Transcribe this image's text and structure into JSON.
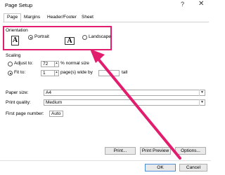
{
  "window": {
    "title": "Page Setup",
    "help": "?",
    "close": "✕"
  },
  "tabs": [
    {
      "label": "Page"
    },
    {
      "label": "Margins"
    },
    {
      "label": "Header/Footer"
    },
    {
      "label": "Sheet"
    }
  ],
  "orientation": {
    "label": "Orientation",
    "portrait": "Portrait",
    "landscape": "Landscape",
    "icon_letter": "A"
  },
  "scaling": {
    "label": "Scaling",
    "adjust_to": "Adjust to:",
    "adjust_value": "72",
    "normal_size": "% normal size",
    "fit_to": "Fit to:",
    "fit_value": "1",
    "pages_wide_by": "page(s) wide by",
    "tall": "tall"
  },
  "paper_size": {
    "label": "Paper size:",
    "value": "A4"
  },
  "print_quality": {
    "label": "Print quality:",
    "value": "Medium"
  },
  "first_page_number": {
    "label": "First page number:",
    "value": "Auto"
  },
  "buttons": {
    "print": "Print...",
    "print_preview": "Print Preview",
    "options": "Options...",
    "ok": "OK",
    "cancel": "Cancel"
  },
  "colors": {
    "highlight": "#e31d6e",
    "default_button_border": "#4a8fd8"
  }
}
